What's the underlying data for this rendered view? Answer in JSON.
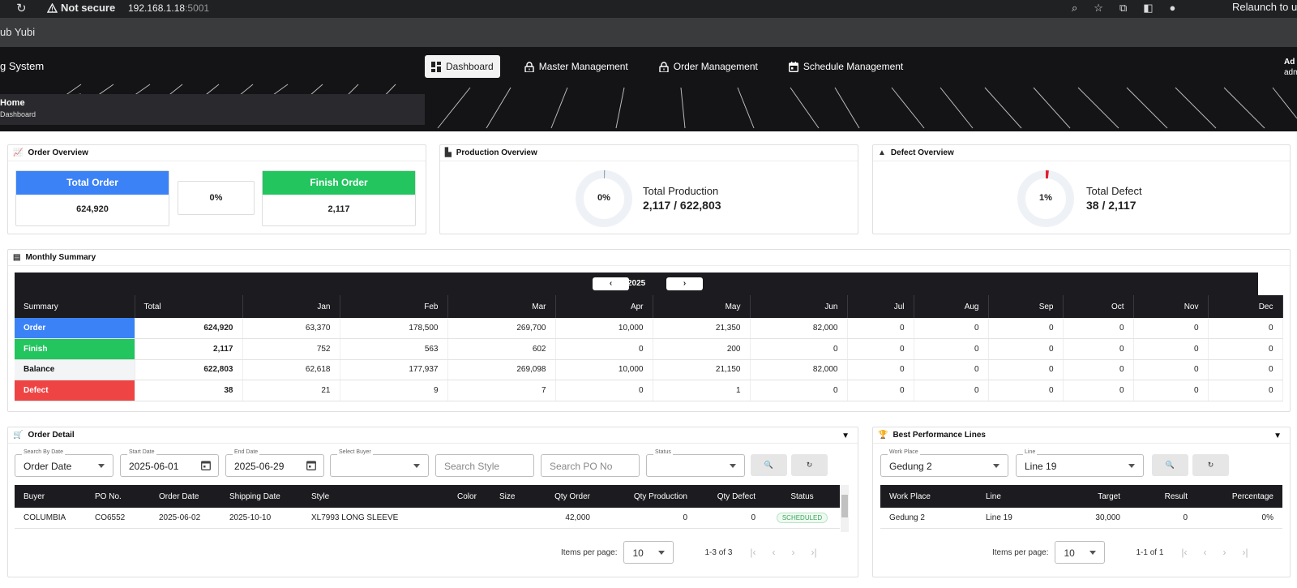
{
  "browser": {
    "security": "Not secure",
    "url_host": "192.168.1.18",
    "url_port": ":5001",
    "relaunch": "Relaunch to u",
    "bookmark": "ub Yubi"
  },
  "header": {
    "title": "g System",
    "nav": [
      {
        "label": "Dashboard",
        "icon": "dashboard-icon"
      },
      {
        "label": "Master Management",
        "icon": "lock-icon"
      },
      {
        "label": "Order Management",
        "icon": "lock-icon"
      },
      {
        "label": "Schedule Management",
        "icon": "calendar-icon"
      }
    ],
    "user_name": "Ad",
    "user_role": "adm",
    "breadcrumb_home": "Home",
    "breadcrumb_page": "Dashboard"
  },
  "order_overview": {
    "title": "Order Overview",
    "total_label": "Total Order",
    "total_value": "624,920",
    "percent": "0%",
    "finish_label": "Finish Order",
    "finish_value": "2,117",
    "colors": {
      "total": "#3b82f6",
      "finish": "#22c55e"
    }
  },
  "production_overview": {
    "title": "Production Overview",
    "percent": "0%",
    "percent_value": 0.34,
    "label": "Total Production",
    "value": "2,117 / 622,803"
  },
  "defect_overview": {
    "title": "Defect Overview",
    "percent": "1%",
    "percent_value": 1.8,
    "label": "Total Defect",
    "value": "38 / 2,117",
    "accent": "#e11d2e"
  },
  "monthly_summary": {
    "title": "Monthly Summary",
    "year": "2025",
    "prev": "‹",
    "next": "›",
    "headers": [
      "Summary",
      "Total",
      "Jan",
      "Feb",
      "Mar",
      "Apr",
      "May",
      "Jun",
      "Jul",
      "Aug",
      "Sep",
      "Oct",
      "Nov",
      "Dec"
    ],
    "rows": [
      {
        "label": "Order",
        "color": "#3b82f6",
        "text": "#ffffff",
        "values": [
          "624,920",
          "63,370",
          "178,500",
          "269,700",
          "10,000",
          "21,350",
          "82,000",
          "0",
          "0",
          "0",
          "0",
          "0",
          "0"
        ]
      },
      {
        "label": "Finish",
        "color": "#22c55e",
        "text": "#ffffff",
        "values": [
          "2,117",
          "752",
          "563",
          "602",
          "0",
          "200",
          "0",
          "0",
          "0",
          "0",
          "0",
          "0",
          "0"
        ]
      },
      {
        "label": "Balance",
        "color": "#f3f4f6",
        "text": "#111111",
        "values": [
          "622,803",
          "62,618",
          "177,937",
          "269,098",
          "10,000",
          "21,150",
          "82,000",
          "0",
          "0",
          "0",
          "0",
          "0",
          "0"
        ]
      },
      {
        "label": "Defect",
        "color": "#ef4444",
        "text": "#ffffff",
        "values": [
          "38",
          "21",
          "9",
          "7",
          "0",
          "1",
          "0",
          "0",
          "0",
          "0",
          "0",
          "0",
          "0"
        ]
      }
    ]
  },
  "order_detail": {
    "title": "Order Detail",
    "search_by_label": "Search By Date",
    "search_by_value": "Order Date",
    "start_label": "Start Date",
    "start_value": "2025-06-01",
    "end_label": "End Date",
    "end_value": "2025-06-29",
    "buyer_label": "Select Buyer",
    "style_placeholder": "Search Style",
    "po_placeholder": "Search PO No",
    "status_label": "Status",
    "search_btn": "🔍",
    "reset_btn": "↻",
    "headers": [
      "Buyer",
      "PO No.",
      "Order Date",
      "Shipping Date",
      "Style",
      "Color",
      "Size",
      "Qty Order",
      "Qty Production",
      "Qty Defect",
      "Status"
    ],
    "rows": [
      {
        "buyer": "COLUMBIA",
        "po": "CO6552",
        "order_date": "2025-06-02",
        "ship_date": "2025-10-10",
        "style": "XL7993 LONG SLEEVE",
        "color": "",
        "size": "",
        "qty_order": "42,000",
        "qty_prod": "0",
        "qty_defect": "0",
        "status": "SCHEDULED"
      }
    ],
    "items_per_page_label": "Items per page:",
    "items_per_page": "10",
    "range": "1-3 of 3"
  },
  "best_lines": {
    "title": "Best Performance Lines",
    "workplace_label": "Work Place",
    "workplace_value": "Gedung 2",
    "line_label": "Line",
    "line_value": "Line 19",
    "headers": [
      "Work Place",
      "Line",
      "Target",
      "Result",
      "Percentage"
    ],
    "rows": [
      {
        "workplace": "Gedung 2",
        "line": "Line 19",
        "target": "30,000",
        "result": "0",
        "percentage": "0%"
      }
    ],
    "items_per_page_label": "Items per page:",
    "items_per_page": "10",
    "range": "1-1 of 1"
  }
}
